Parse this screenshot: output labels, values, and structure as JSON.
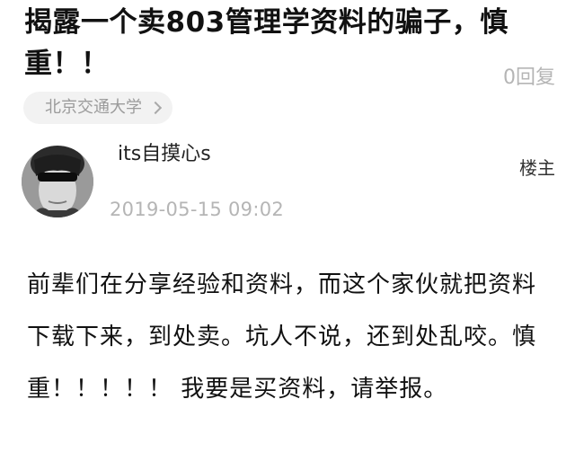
{
  "post": {
    "title": "揭露一个卖803管理学资料的骗子，慎重！！",
    "reply_count": "0回复",
    "forum": "北京交通大学",
    "author": {
      "name": "its自摸心s",
      "badge": "楼主",
      "timestamp": "2019-05-15 09:02"
    },
    "body": "前辈们在分享经验和资料，而这个家伙就把资料下载下来，到处卖。坑人不说，还到处乱咬。慎重！！！！！ 我要是买资料，请举报。"
  },
  "icons": {
    "forum_chevron": "chevron-right-icon",
    "avatar": "avatar"
  },
  "colors": {
    "title": "#111111",
    "muted": "#b5b5b5",
    "tag_background": "#f2f2f2",
    "body": "#111111"
  }
}
